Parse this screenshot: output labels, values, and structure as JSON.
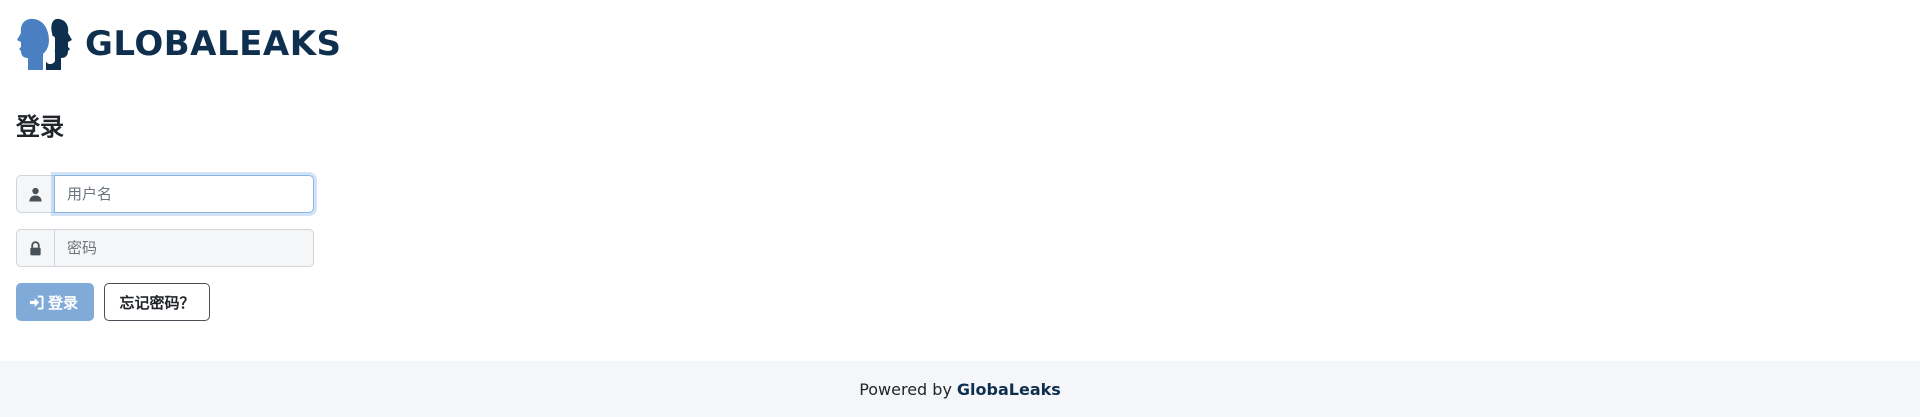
{
  "brand": {
    "logo_text": "GLOBALEAKS",
    "colors": {
      "primary": "#0f2f4f",
      "secondary": "#4a7fc1"
    }
  },
  "page": {
    "title": "登录"
  },
  "form": {
    "username": {
      "icon": "user-icon",
      "placeholder": "用户名",
      "value": ""
    },
    "password": {
      "icon": "lock-icon",
      "placeholder": "密码",
      "value": ""
    },
    "login_button": {
      "icon": "sign-in-icon",
      "label": "登录"
    },
    "forgot_button": {
      "label": "忘记密码？"
    }
  },
  "footer": {
    "prefix": "Powered by",
    "brand": "GlobaLeaks"
  }
}
